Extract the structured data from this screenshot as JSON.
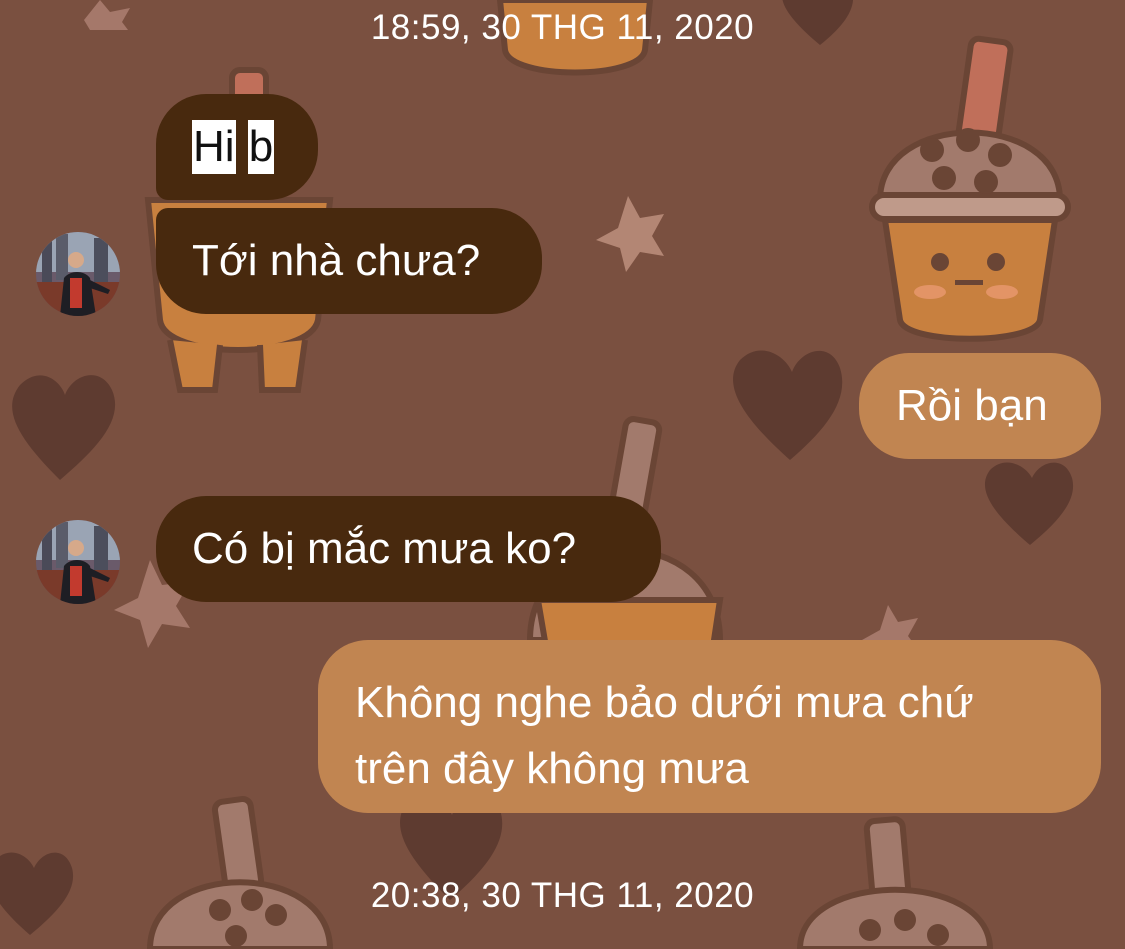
{
  "chat": {
    "timestamp_top": "18:59, 30 THG 11, 2020",
    "timestamp_bottom": "20:38, 30 THG 11, 2020",
    "messages": [
      {
        "sender": "contact",
        "words": [
          "Hi",
          "b"
        ],
        "highlighted": true
      },
      {
        "sender": "contact",
        "text": "Tới nhà chưa?"
      },
      {
        "sender": "me",
        "text": "Rồi bạn"
      },
      {
        "sender": "contact",
        "text": "Có bị mắc mưa ko?"
      },
      {
        "sender": "me",
        "lines": [
          "Không nghe bảo dưới mưa chứ",
          "trên đây không mưa"
        ]
      }
    ]
  },
  "theme": {
    "background": "#7a5040",
    "incoming_bubble": "#48290e",
    "outgoing_bubble": "#c18551",
    "text": "#ffffff",
    "background_pattern": [
      "boba-cup-icon",
      "heart-icon",
      "star-icon"
    ]
  }
}
